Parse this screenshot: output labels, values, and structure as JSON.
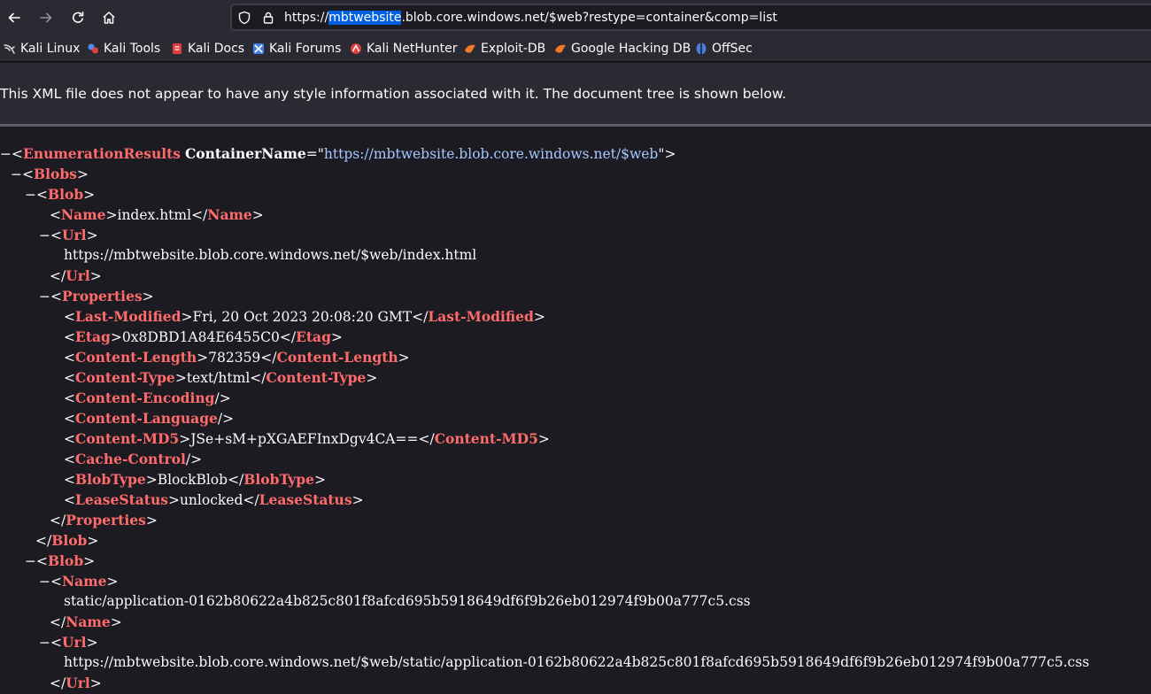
{
  "browser": {
    "url_scheme": "https://",
    "url_selected": "mbtwebsite",
    "url_rest": ".blob.core.windows.net/$web?restype=container&comp=list",
    "nav": [
      "back-icon",
      "forward-icon",
      "reload-icon",
      "home-icon"
    ]
  },
  "bookmarks": [
    {
      "label": "Kali Linux",
      "icon": "kali-dragon-icon",
      "color": "#e0e0e0"
    },
    {
      "label": "Kali Tools",
      "icon": "kali-tools-icon",
      "color": "#4f8df5"
    },
    {
      "label": "Kali Docs",
      "icon": "kali-docs-icon",
      "color": "#e03c3c"
    },
    {
      "label": "Kali Forums",
      "icon": "kali-forums-icon",
      "color": "#3d7fe6"
    },
    {
      "label": "Kali NetHunter",
      "icon": "nethunter-icon",
      "color": "#e04040"
    },
    {
      "label": "Exploit-DB",
      "icon": "exploit-db-icon",
      "color": "#f07a2a"
    },
    {
      "label": "Google Hacking DB",
      "icon": "ghdb-icon",
      "color": "#f07a2a"
    },
    {
      "label": "OffSec",
      "icon": "offsec-icon",
      "color": "#4a7bd8"
    }
  ],
  "viewer": {
    "info": "This XML file does not appear to have any style information associated with it. The document tree is shown below."
  },
  "xml": {
    "toggle": "−",
    "root_tag": "EnumerationResults",
    "root_attr": "ContainerName",
    "root_attr_value": "https://mbtwebsite.blob.core.windows.net/$web",
    "blobs_tag": "Blobs",
    "blob_tag": "Blob",
    "name_tag": "Name",
    "url_tag": "Url",
    "props_tag": "Properties",
    "blob1": {
      "name": "index.html",
      "url": "https://mbtwebsite.blob.core.windows.net/$web/index.html",
      "properties": [
        {
          "tag": "Last-Modified",
          "value": "Fri, 20 Oct 2023 20:08:20 GMT"
        },
        {
          "tag": "Etag",
          "value": "0x8DBD1A84E6455C0"
        },
        {
          "tag": "Content-Length",
          "value": "782359"
        },
        {
          "tag": "Content-Type",
          "value": "text/html"
        },
        {
          "tag": "Content-Encoding",
          "value": null
        },
        {
          "tag": "Content-Language",
          "value": null
        },
        {
          "tag": "Content-MD5",
          "value": "JSe+sM+pXGAEFInxDgv4CA=="
        },
        {
          "tag": "Cache-Control",
          "value": null
        },
        {
          "tag": "BlobType",
          "value": "BlockBlob"
        },
        {
          "tag": "LeaseStatus",
          "value": "unlocked"
        }
      ]
    },
    "blob2": {
      "name": "static/application-0162b80622a4b825c801f8afcd695b5918649df6f9b26eb012974f9b00a777c5.css",
      "url": "https://mbtwebsite.blob.core.windows.net/$web/static/application-0162b80622a4b825c801f8afcd695b5918649df6f9b26eb012974f9b00a777c5.css"
    }
  }
}
